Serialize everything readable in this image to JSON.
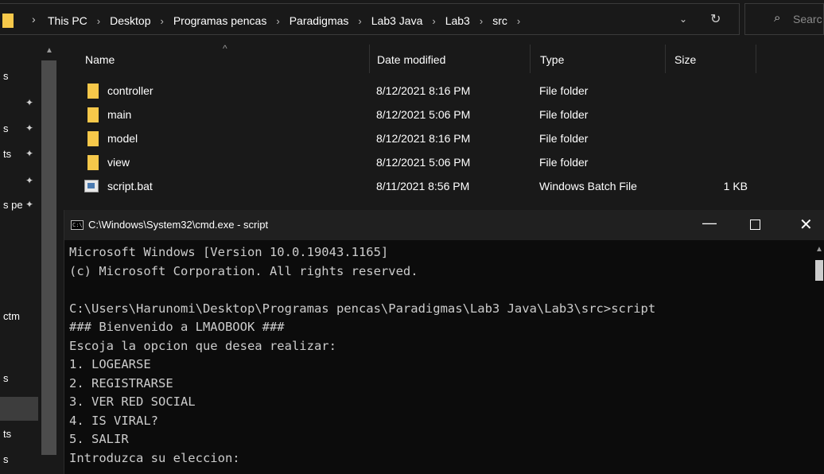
{
  "address_bar": {
    "breadcrumbs": [
      "This PC",
      "Desktop",
      "Programas pencas",
      "Paradigmas",
      "Lab3 Java",
      "Lab3",
      "src"
    ],
    "search_placeholder": "Searc"
  },
  "nav_pane": {
    "items": [
      {
        "label": "s",
        "pinned": false
      },
      {
        "label": "",
        "pinned": true
      },
      {
        "label": "s",
        "pinned": true
      },
      {
        "label": "ts",
        "pinned": true
      },
      {
        "label": "",
        "pinned": true
      },
      {
        "label": "s pe",
        "pinned": true
      },
      {
        "label": "ctm",
        "pinned": false
      },
      {
        "label": "s",
        "pinned": false
      },
      {
        "label": "ts",
        "pinned": false
      },
      {
        "label": "s",
        "pinned": false
      }
    ]
  },
  "file_list": {
    "columns": [
      "Name",
      "Date modified",
      "Type",
      "Size"
    ],
    "rows": [
      {
        "name": "controller",
        "date": "8/12/2021 8:16 PM",
        "type": "File folder",
        "size": "",
        "icon": "folder-icon"
      },
      {
        "name": "main",
        "date": "8/12/2021 5:06 PM",
        "type": "File folder",
        "size": "",
        "icon": "folder-icon"
      },
      {
        "name": "model",
        "date": "8/12/2021 8:16 PM",
        "type": "File folder",
        "size": "",
        "icon": "folder-icon"
      },
      {
        "name": "view",
        "date": "8/12/2021 5:06 PM",
        "type": "File folder",
        "size": "",
        "icon": "folder-icon"
      },
      {
        "name": "script.bat",
        "date": "8/11/2021 8:56 PM",
        "type": "Windows Batch File",
        "size": "1 KB",
        "icon": "batch-file-icon"
      }
    ]
  },
  "cmd_window": {
    "title": "C:\\Windows\\System32\\cmd.exe - script",
    "icon_text": "C:\\",
    "lines": [
      "Microsoft Windows [Version 10.0.19043.1165]",
      "(c) Microsoft Corporation. All rights reserved.",
      "",
      "C:\\Users\\Harunomi\\Desktop\\Programas pencas\\Paradigmas\\Lab3 Java\\Lab3\\src>script",
      "### Bienvenido a LMAOBOOK ###",
      "Escoja la opcion que desea realizar:",
      "1. LOGEARSE",
      "2. REGISTRARSE",
      "3. VER RED SOCIAL",
      "4. IS VIRAL?",
      "5. SALIR",
      "Introduzca su eleccion:"
    ]
  },
  "colors": {
    "explorer_bg": "#191919",
    "folder": "#f6c84a",
    "console_bg": "#0c0c0c",
    "console_text": "#cccccc",
    "titlebar": "#202020"
  }
}
